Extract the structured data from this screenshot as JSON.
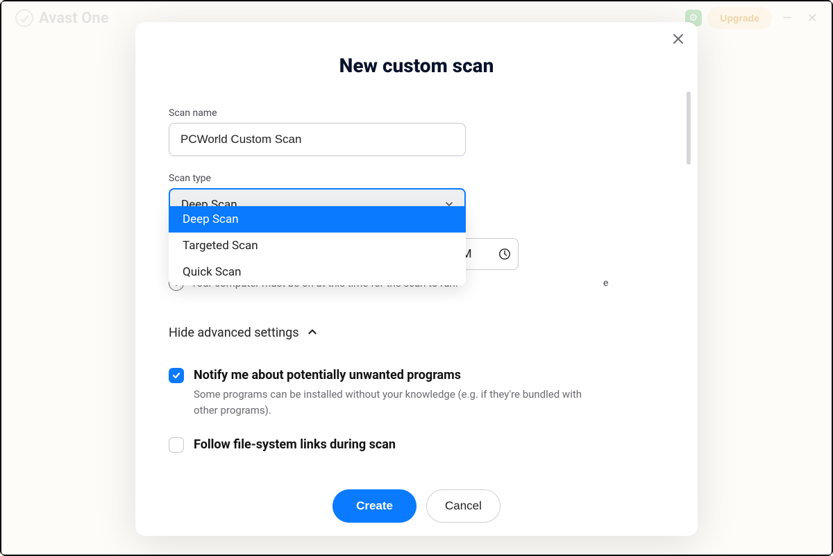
{
  "app": {
    "title": "Avast One",
    "upgrade_label": "Upgrade"
  },
  "modal": {
    "title": "New custom scan",
    "scan_name_label": "Scan name",
    "scan_name_value": "PCWorld Custom Scan",
    "scan_type_label": "Scan type",
    "scan_type_selected": "Deep Scan",
    "scan_type_options": [
      "Deep Scan",
      "Targeted Scan",
      "Quick Scan"
    ],
    "time_value": "PM",
    "time_partial_label": "e",
    "info_text": "Your computer must be on at this time for the scan to run.",
    "advanced_toggle_label": "Hide advanced settings",
    "setting_notify": {
      "title": "Notify me about potentially unwanted programs",
      "desc": "Some programs can be installed without your knowledge (e.g. if they're bundled with other programs).",
      "checked": true
    },
    "setting_follow_links": {
      "title": "Follow file-system links during scan",
      "checked": false
    },
    "create_label": "Create",
    "cancel_label": "Cancel"
  },
  "colors": {
    "primary": "#0a7aff",
    "text_muted": "#6b6b72"
  }
}
